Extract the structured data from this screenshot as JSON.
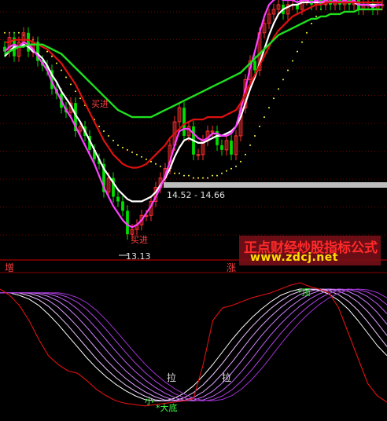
{
  "colors": {
    "background": "#000000",
    "separator": "#8a0000",
    "grid": "#a00000",
    "up_candle": "#ff3030",
    "down_candle": "#00e000",
    "yellow": "#ffd000",
    "white_line": "#ffffff",
    "magenta_line": "#ff40ff",
    "red_line": "#e01010",
    "green_line": "#20e020",
    "dots": "#ffff40",
    "range_bar": "#bdbdbd",
    "text_red": "#ff4040",
    "text_green": "#40ff40",
    "text_white": "#e0e0e0"
  },
  "watermark": {
    "title": "正点财经炒股指标公式",
    "url": "www.zdcj.net"
  },
  "panel_labels": {
    "left": "增",
    "right": "涨"
  },
  "annotations": {
    "buy_signal_upper": "买进",
    "buy_signal_lower": "买进",
    "low_price": "13.13",
    "range_text": "14.52 - 14.66",
    "top_marker": "*顶",
    "pull_1": "拉",
    "pull_2": "拉",
    "small_mark": "小",
    "big_bottom": "*大底"
  },
  "chart_data": [
    {
      "type": "line",
      "title": "",
      "note": "Upper panel: candlestick price chart with overlaid moving averages and dotted band",
      "x": [
        0,
        1,
        2,
        3,
        4,
        5,
        6,
        7,
        8,
        9,
        10,
        11,
        12,
        13,
        14,
        15,
        16,
        17,
        18,
        19,
        20,
        21,
        22,
        23,
        24,
        25,
        26,
        27,
        28,
        29,
        30,
        31,
        32,
        33,
        34,
        35,
        36,
        37,
        38,
        39,
        40,
        41,
        42,
        43,
        44,
        45,
        46,
        47,
        48,
        49,
        50,
        51,
        52,
        53,
        54,
        55,
        56,
        57,
        58,
        59,
        60,
        61,
        62,
        63,
        64,
        65,
        66,
        67,
        68,
        69,
        70,
        71,
        72,
        73,
        74,
        75,
        76,
        77,
        78,
        79,
        80
      ],
      "ylim": [
        12.8,
        18.3
      ],
      "annotated_low": 13.13,
      "annotated_range": [
        14.52,
        14.66
      ],
      "candles": {
        "open": [
          17.3,
          17.2,
          17.5,
          17.1,
          17.4,
          17.6,
          17.2,
          17.4,
          17.0,
          16.9,
          16.8,
          16.4,
          16.3,
          16.0,
          15.9,
          16.1,
          15.5,
          15.6,
          15.4,
          15.1,
          14.9,
          14.8,
          14.2,
          14.5,
          14.1,
          14.0,
          13.8,
          13.3,
          13.4,
          13.5,
          13.7,
          13.7,
          14.0,
          14.3,
          14.5,
          14.7,
          15.2,
          15.7,
          16.0,
          15.4,
          15.6,
          15.0,
          15.0,
          15.3,
          15.5,
          15.5,
          15.2,
          15.1,
          15.3,
          15.0,
          15.4,
          16.0,
          16.6,
          17.0,
          16.8,
          17.6,
          17.8,
          18.0,
          18.1,
          18.2,
          18.0,
          18.2,
          18.2,
          18.1,
          18.3,
          18.3,
          18.2,
          18.3,
          18.2,
          18.3,
          18.2,
          18.3,
          18.2,
          18.3,
          18.2,
          18.3,
          18.1,
          18.2,
          18.2,
          18.1,
          18.2
        ],
        "close": [
          17.2,
          17.5,
          17.1,
          17.4,
          17.6,
          17.2,
          17.4,
          17.0,
          16.9,
          16.8,
          16.4,
          16.3,
          16.0,
          15.9,
          16.1,
          15.5,
          15.6,
          15.4,
          15.1,
          14.9,
          14.8,
          14.2,
          14.5,
          14.1,
          14.0,
          13.8,
          13.3,
          13.4,
          13.5,
          13.7,
          13.7,
          14.0,
          14.3,
          14.5,
          14.7,
          15.2,
          15.7,
          16.0,
          15.4,
          15.6,
          15.0,
          15.0,
          15.3,
          15.5,
          15.5,
          15.2,
          15.1,
          15.3,
          15.0,
          15.4,
          16.0,
          16.6,
          17.0,
          16.8,
          17.6,
          17.8,
          18.0,
          18.1,
          18.2,
          18.0,
          18.2,
          18.2,
          18.1,
          18.3,
          18.3,
          18.2,
          18.3,
          18.2,
          18.3,
          18.2,
          18.3,
          18.2,
          18.3,
          18.2,
          18.3,
          18.1,
          18.2,
          18.2,
          18.1,
          18.2,
          18.2
        ]
      },
      "series": [
        {
          "values": [
            17.1,
            17.2,
            17.3,
            17.3,
            17.35,
            17.3,
            17.2,
            17.15,
            17.05,
            16.9,
            16.7,
            16.55,
            16.35,
            16.2,
            16.05,
            15.85,
            15.7,
            15.5,
            15.3,
            15.1,
            14.9,
            14.7,
            14.55,
            14.4,
            14.25,
            14.15,
            14.05,
            14.0,
            14.0,
            14.0,
            14.05,
            14.1,
            14.2,
            14.35,
            14.5,
            14.7,
            14.95,
            15.15,
            15.3,
            15.35,
            15.3,
            15.25,
            15.25,
            15.3,
            15.35,
            15.4,
            15.4,
            15.45,
            15.5,
            15.6,
            15.8,
            16.1,
            16.4,
            16.65,
            16.95,
            17.25,
            17.55,
            17.8,
            18.0,
            18.1,
            18.15,
            18.2,
            18.2,
            18.25,
            18.25,
            18.25,
            18.25,
            18.25,
            18.25,
            18.25,
            18.25,
            18.25,
            18.25,
            18.25,
            18.25,
            18.2,
            18.2,
            18.2,
            18.2,
            18.2,
            18.2
          ]
        },
        {
          "values": [
            17.2,
            17.3,
            17.35,
            17.3,
            17.4,
            17.35,
            17.25,
            17.1,
            16.95,
            16.8,
            16.55,
            16.35,
            16.15,
            15.95,
            15.8,
            15.6,
            15.4,
            15.2,
            15.0,
            14.8,
            14.55,
            14.3,
            14.1,
            13.9,
            13.75,
            13.6,
            13.5,
            13.45,
            13.5,
            13.6,
            13.75,
            13.9,
            14.1,
            14.3,
            14.55,
            14.85,
            15.2,
            15.5,
            15.55,
            15.55,
            15.45,
            15.35,
            15.3,
            15.35,
            15.45,
            15.45,
            15.4,
            15.4,
            15.45,
            15.6,
            15.95,
            16.4,
            16.85,
            17.2,
            17.6,
            17.95,
            18.2,
            18.3,
            18.35,
            18.3,
            18.3,
            18.3,
            18.25,
            18.3,
            18.3,
            18.25,
            18.3,
            18.25,
            18.3,
            18.25,
            18.3,
            18.25,
            18.3,
            18.25,
            18.3,
            18.2,
            18.2,
            18.2,
            18.15,
            18.2,
            18.2
          ]
        },
        {
          "values": [
            17.4,
            17.4,
            17.45,
            17.45,
            17.45,
            17.45,
            17.4,
            17.35,
            17.3,
            17.25,
            17.15,
            17.05,
            16.95,
            16.8,
            16.65,
            16.5,
            16.3,
            16.1,
            15.9,
            15.7,
            15.5,
            15.3,
            15.15,
            15.0,
            14.9,
            14.8,
            14.75,
            14.72,
            14.72,
            14.75,
            14.8,
            14.9,
            15.0,
            15.1,
            15.2,
            15.35,
            15.45,
            15.55,
            15.65,
            15.7,
            15.75,
            15.75,
            15.75,
            15.8,
            15.8,
            15.8,
            15.8,
            15.85,
            15.9,
            15.95,
            16.1,
            16.3,
            16.5,
            16.7,
            16.9,
            17.1,
            17.3,
            17.5,
            17.65,
            17.75,
            17.85,
            17.95,
            18.0,
            18.05,
            18.1,
            18.15,
            18.2,
            18.2,
            18.25,
            18.25,
            18.25,
            18.25,
            18.25,
            18.25,
            18.25,
            18.25,
            18.25,
            18.25,
            18.25,
            18.25,
            18.25
          ]
        },
        {
          "values": [
            17.15,
            17.2,
            17.25,
            17.3,
            17.3,
            17.35,
            17.35,
            17.35,
            17.35,
            17.3,
            17.25,
            17.2,
            17.15,
            17.05,
            16.95,
            16.85,
            16.75,
            16.65,
            16.55,
            16.45,
            16.35,
            16.25,
            16.15,
            16.05,
            15.95,
            15.9,
            15.85,
            15.8,
            15.8,
            15.8,
            15.8,
            15.8,
            15.85,
            15.9,
            15.95,
            16.0,
            16.05,
            16.1,
            16.15,
            16.2,
            16.25,
            16.3,
            16.35,
            16.4,
            16.45,
            16.5,
            16.55,
            16.6,
            16.65,
            16.7,
            16.75,
            16.85,
            16.95,
            17.05,
            17.15,
            17.25,
            17.35,
            17.45,
            17.55,
            17.6,
            17.65,
            17.7,
            17.75,
            17.8,
            17.85,
            17.9,
            17.9,
            17.95,
            17.95,
            18.0,
            18.0,
            18.0,
            18.05,
            18.05,
            18.05,
            18.1,
            18.1,
            18.1,
            18.1,
            18.1,
            18.1
          ]
        },
        {
          "values": [
            17.6,
            17.6,
            17.6,
            17.6,
            17.55,
            17.5,
            17.45,
            17.4,
            17.3,
            17.2,
            17.1,
            16.95,
            16.8,
            16.65,
            16.5,
            16.35,
            16.2,
            16.05,
            15.9,
            15.75,
            15.6,
            15.5,
            15.4,
            15.3,
            15.2,
            15.15,
            15.1,
            15.05,
            15.0,
            14.95,
            14.9,
            14.85,
            14.8,
            14.75,
            14.7,
            14.65,
            14.6,
            14.6,
            14.55,
            14.55,
            14.5,
            14.5,
            14.5,
            14.5,
            14.55,
            14.55,
            14.6,
            14.65,
            14.7,
            14.75,
            14.85,
            15.0,
            15.2,
            15.4,
            15.6,
            15.8,
            16.0,
            16.2,
            16.4,
            16.6,
            16.8,
            17.0,
            17.2,
            17.4,
            17.6,
            17.8,
            17.95,
            18.1,
            18.2,
            18.3,
            18.4,
            18.5,
            18.55,
            18.6,
            18.65,
            18.7,
            18.75,
            18.8,
            18.85,
            18.9,
            18.95
          ]
        }
      ]
    },
    {
      "type": "line",
      "title": "",
      "note": "Lower panel: oscillator with red driver line and fan of smoothed lines",
      "ylim": [
        0,
        100
      ],
      "x": [
        0,
        1,
        2,
        3,
        4,
        5,
        6,
        7,
        8,
        9,
        10,
        11,
        12,
        13,
        14,
        15,
        16,
        17,
        18,
        19,
        20,
        21,
        22,
        23,
        24,
        25,
        26,
        27,
        28,
        29,
        30,
        31,
        32,
        33,
        34,
        35,
        36,
        37,
        38,
        39,
        40
      ],
      "series": [
        {
          "values": [
            95,
            90,
            82,
            70,
            55,
            42,
            35,
            30,
            28,
            22,
            15,
            10,
            6,
            4,
            3,
            2,
            3,
            4,
            5,
            6,
            8,
            35,
            70,
            80,
            82,
            85,
            88,
            90,
            92,
            95,
            98,
            100,
            97,
            95,
            92,
            80,
            60,
            40,
            20,
            10,
            5
          ]
        },
        {
          "values": [
            92,
            92,
            90,
            87,
            82,
            75,
            67,
            58,
            49,
            40,
            32,
            25,
            19,
            14,
            10,
            7,
            6,
            6,
            8,
            12,
            18,
            26,
            35,
            45,
            55,
            64,
            72,
            79,
            85,
            90,
            93,
            95,
            95,
            94,
            91,
            86,
            79,
            70,
            60,
            50,
            42
          ]
        }
      ]
    }
  ]
}
